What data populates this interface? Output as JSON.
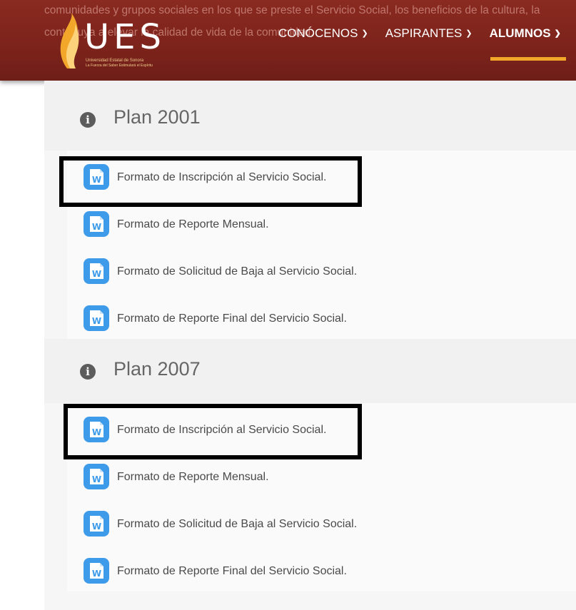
{
  "header": {
    "background_text_line1": "comunidades y grupos sociales en los que se preste el Servicio Social, los beneficios de la cultura, la",
    "background_text_line2": "contribuya a elevar la calidad de vida de la comunidad.",
    "logo_text": "UES",
    "logo_subtitle1": "Universidad Estatal de Sonora",
    "logo_subtitle2": "La Fuerza del Saber Estimulará el Espíritu",
    "nav": [
      {
        "label": "CONÓCENOS"
      },
      {
        "label": "ASPIRANTES"
      },
      {
        "label": "ALUMNOS"
      }
    ],
    "active_nav": "ALUMNOS",
    "colors": {
      "header": "#7c231b",
      "accent": "#f2a72a"
    }
  },
  "sections": [
    {
      "title": "Plan 2001",
      "icon": "info-icon",
      "items": [
        {
          "label": "Formato de Inscripción al Servicio Social.",
          "icon": "word-doc-icon"
        },
        {
          "label": "Formato de Reporte Mensual.",
          "icon": "word-doc-icon"
        },
        {
          "label": "Formato de Solicitud de Baja al Servicio Social.",
          "icon": "word-doc-icon"
        },
        {
          "label": "Formato de Reporte Final del Servicio Social.",
          "icon": "word-doc-icon"
        }
      ]
    },
    {
      "title": "Plan 2007",
      "icon": "info-icon",
      "items": [
        {
          "label": "Formato de Inscripción al Servicio Social.",
          "icon": "word-doc-icon"
        },
        {
          "label": "Formato de Reporte Mensual.",
          "icon": "word-doc-icon"
        },
        {
          "label": "Formato de Solicitud de Baja al Servicio Social.",
          "icon": "word-doc-icon"
        },
        {
          "label": "Formato de Reporte Final del Servicio Social.",
          "icon": "word-doc-icon"
        }
      ]
    }
  ]
}
